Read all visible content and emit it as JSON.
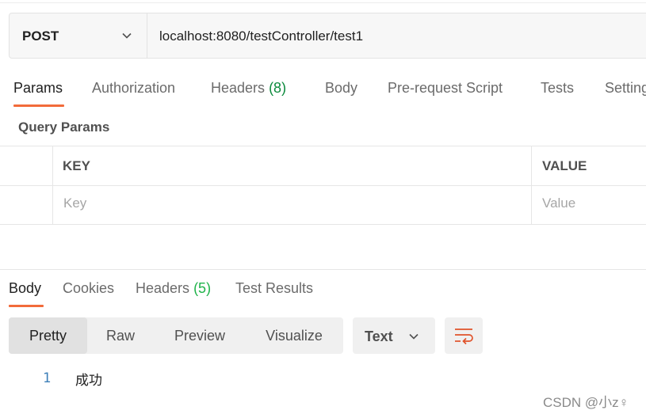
{
  "request": {
    "method": "POST",
    "url": "localhost:8080/testController/test1"
  },
  "request_tabs": {
    "params": "Params",
    "authorization": "Authorization",
    "headers": "Headers",
    "headers_count": "(8)",
    "body": "Body",
    "pre_request": "Pre-request Script",
    "tests": "Tests",
    "settings": "Settings"
  },
  "query_params": {
    "title": "Query Params",
    "columns": {
      "key": "KEY",
      "value": "VALUE"
    },
    "placeholder": {
      "key": "Key",
      "value": "Value"
    }
  },
  "response_tabs": {
    "body": "Body",
    "cookies": "Cookies",
    "headers": "Headers",
    "headers_count": "(5)",
    "test_results": "Test Results"
  },
  "view_modes": {
    "pretty": "Pretty",
    "raw": "Raw",
    "preview": "Preview",
    "visualize": "Visualize"
  },
  "format": {
    "selected": "Text"
  },
  "response_body": {
    "lines": [
      {
        "number": "1",
        "text": "成功"
      }
    ]
  },
  "watermark": "CSDN @小z♀",
  "colors": {
    "accent_orange": "#f26b3a",
    "count_green": "#0b8a3c",
    "line_number_blue": "#3d7fb8"
  },
  "icons": {
    "method_dropdown": "chevron-down-icon",
    "format_dropdown": "chevron-down-icon",
    "wrap": "wrap-lines-icon"
  }
}
